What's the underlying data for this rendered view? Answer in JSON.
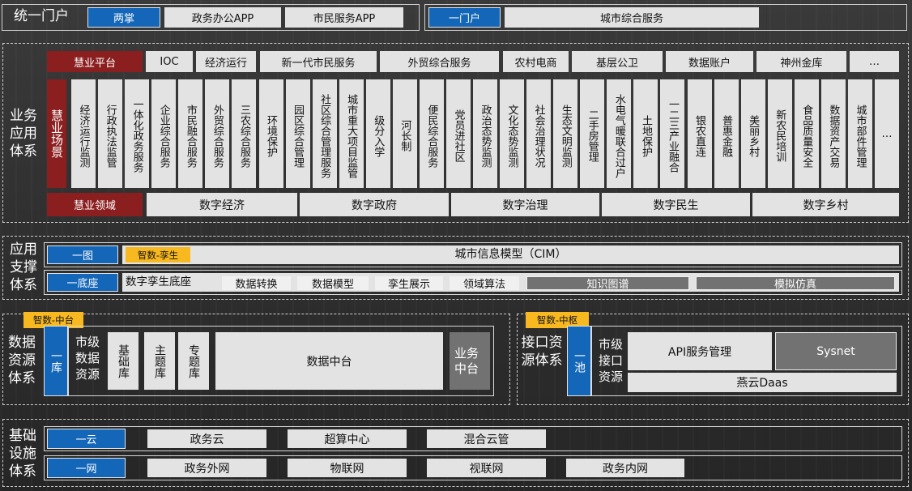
{
  "unified_portal": {
    "title": "统一门户",
    "two_palm": "两掌",
    "gov_app": "政务办公APP",
    "citizen_app": "市民服务APP",
    "one_portal": "一门户",
    "city_service": "城市综合服务"
  },
  "business": {
    "title": "业务应用体系",
    "platform_label": "慧业平台",
    "platforms": [
      "IOC",
      "经济运行",
      "新一代市民服务",
      "外贸综合服务",
      "农村电商",
      "基层公卫",
      "数据账户",
      "神州金库",
      "…"
    ],
    "scenes_label": "慧业场景",
    "scenes": [
      "经济运行监测",
      "行政执法监管",
      "一体化政务服务",
      "企业综合服务",
      "市民融合服务",
      "外贸综合服务",
      "三农综合服务",
      "环境保护",
      "园区综合管理",
      "社区综合管理服务",
      "城市重大项目监管",
      "级分入学",
      "河长制",
      "便民综合服务",
      "党员进社区",
      "政治态势监测",
      "文化态势监测",
      "社会治理状况",
      "生态文明监测",
      "二手房管理",
      "水电气暖联合过户",
      "土地保护",
      "一二三产业融合",
      "银农直连",
      "普惠金融",
      "美丽乡村",
      "新农民培训",
      "食品质量安全",
      "数据资产交易",
      "城市部件管理",
      "…"
    ],
    "domain_label": "慧业领域",
    "domains": [
      "数字经济",
      "数字政府",
      "数字治理",
      "数字民生",
      "数字乡村"
    ]
  },
  "support": {
    "title": "应用支撑体系",
    "one_map": "一图",
    "twin_badge": "智数-孪生",
    "cim": "城市信息模型（CIM）",
    "one_base": "一底座",
    "twin_base": "数字孪生底座",
    "tools": [
      "数据转换",
      "数据模型",
      "孪生展示",
      "领域算法"
    ],
    "knowledge": "知识图谱",
    "simulation": "模拟仿真"
  },
  "data_res": {
    "badge": "智数-中台",
    "title": "数据资源体系",
    "one_lib": "一库",
    "city_res": "市级数据资源",
    "libs": [
      "基础库",
      "主题库",
      "专题库"
    ],
    "middle": "数据中台",
    "biz_middle": "业务中台"
  },
  "iface": {
    "badge": "智数-中枢",
    "title": "接口资源体系",
    "one_pool": "一池",
    "city_res": "市级接口资源",
    "api": "API服务管理",
    "sysnet": "Sysnet",
    "daas": "燕云Daas"
  },
  "infra": {
    "title": "基础设施体系",
    "one_cloud": "一云",
    "clouds": [
      "政务云",
      "超算中心",
      "混合云管"
    ],
    "one_net": "一网",
    "nets": [
      "政务外网",
      "物联网",
      "视联网",
      "政务内网"
    ]
  },
  "colors": {
    "blue": "#1466b8",
    "red": "#8b1e1e",
    "yellow": "#f7b820",
    "gray": "#e3e3e3",
    "dark_gray": "#727272"
  }
}
